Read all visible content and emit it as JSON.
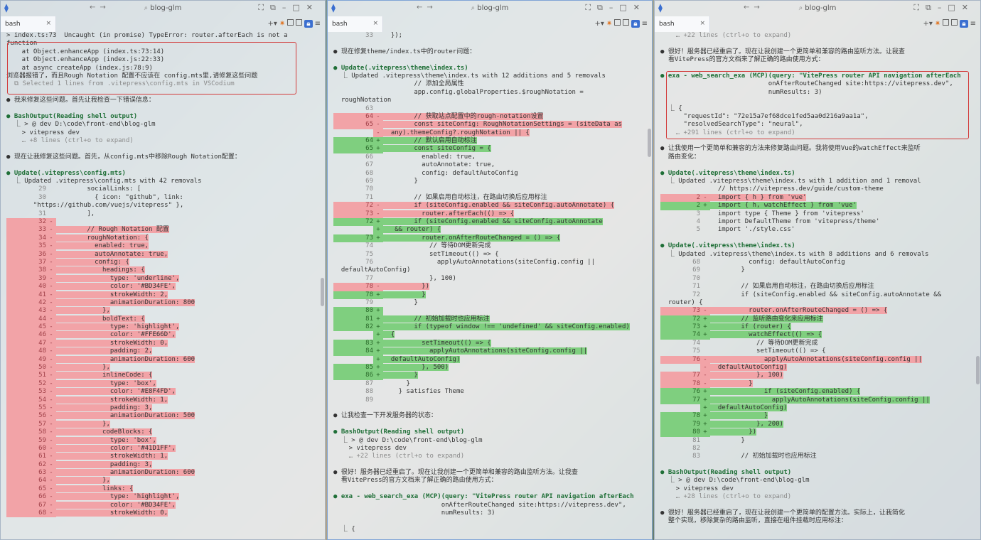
{
  "windows": [
    {
      "title": "blog-glm",
      "tab": "bash",
      "lines": [
        {
          "t": "> index.ts:73  Uncaught (in promise) TypeError: router.afterEach is not a"
        },
        {
          "t": "function"
        },
        {
          "t": "    at Object.enhanceApp (index.ts:73:14)"
        },
        {
          "t": "    at Object.enhanceApp (index.js:22:33)"
        },
        {
          "t": "    at async createApp (index.js:78:9)"
        },
        {
          "t": "浏览器报错了，而且Rough Notation 配置不应该在 config.mts里,请修复这些问题"
        },
        {
          "t": "  ⧉ Selected 1 lines from .vitepress\\config.mts in VSCodium",
          "c": "gray"
        },
        {
          "t": ""
        },
        {
          "t": "● 我来修复这些问题。首先让我检查一下错误信息："
        },
        {
          "t": ""
        },
        {
          "t": "● BashOutput(Reading shell output)",
          "c": "tool"
        },
        {
          "t": "  ⎿ > @ dev D:\\code\\front-end\\blog-glm"
        },
        {
          "t": "    > vitepress dev"
        },
        {
          "t": "    … +8 lines (ctrl+o to expand)",
          "c": "gray"
        },
        {
          "t": ""
        },
        {
          "t": "● 现在让我修复这些问题。首先，从config.mts中移除Rough Notation配置："
        },
        {
          "t": ""
        },
        {
          "t": "● Update(.vitepress\\config.mts)",
          "c": "tool"
        },
        {
          "t": "  ⎿ Updated .vitepress\\config.mts with 42 removals"
        },
        {
          "n": "29",
          "t": "        socialLinks: ["
        },
        {
          "n": "30",
          "t": "          { icon: \"github\", link:"
        },
        {
          "t": "       \"https://github.com/vuejs/vitepress\" },"
        },
        {
          "n": "31",
          "t": "        ],"
        },
        {
          "n": "32",
          "m": "-",
          "d": "r",
          "t": ""
        },
        {
          "n": "33",
          "m": "-",
          "d": "r",
          "t": "        // Rough Notation 配置"
        },
        {
          "n": "34",
          "m": "-",
          "d": "r",
          "t": "        roughNotation: {"
        },
        {
          "n": "35",
          "m": "-",
          "d": "r",
          "t": "          enabled: true,"
        },
        {
          "n": "36",
          "m": "-",
          "d": "r",
          "t": "          autoAnnotate: true,"
        },
        {
          "n": "37",
          "m": "-",
          "d": "r",
          "t": "          config: {"
        },
        {
          "n": "38",
          "m": "-",
          "d": "r",
          "t": "            headings: {"
        },
        {
          "n": "39",
          "m": "-",
          "d": "r",
          "t": "              type: 'underline',"
        },
        {
          "n": "40",
          "m": "-",
          "d": "r",
          "t": "              color: '#BD34FE',"
        },
        {
          "n": "41",
          "m": "-",
          "d": "r",
          "t": "              strokeWidth: 2,"
        },
        {
          "n": "42",
          "m": "-",
          "d": "r",
          "t": "              animationDuration: 800"
        },
        {
          "n": "43",
          "m": "-",
          "d": "r",
          "t": "            },"
        },
        {
          "n": "44",
          "m": "-",
          "d": "r",
          "t": "            boldText: {"
        },
        {
          "n": "45",
          "m": "-",
          "d": "r",
          "t": "              type: 'highlight',"
        },
        {
          "n": "46",
          "m": "-",
          "d": "r",
          "t": "              color: '#FFE66D',"
        },
        {
          "n": "47",
          "m": "-",
          "d": "r",
          "t": "              strokeWidth: 0,"
        },
        {
          "n": "48",
          "m": "-",
          "d": "r",
          "t": "              padding: 2,"
        },
        {
          "n": "49",
          "m": "-",
          "d": "r",
          "t": "              animationDuration: 600"
        },
        {
          "n": "50",
          "m": "-",
          "d": "r",
          "t": "            },"
        },
        {
          "n": "51",
          "m": "-",
          "d": "r",
          "t": "            inlineCode: {"
        },
        {
          "n": "52",
          "m": "-",
          "d": "r",
          "t": "              type: 'box',"
        },
        {
          "n": "53",
          "m": "-",
          "d": "r",
          "t": "              color: '#E8F4FD',"
        },
        {
          "n": "54",
          "m": "-",
          "d": "r",
          "t": "              strokeWidth: 1,"
        },
        {
          "n": "55",
          "m": "-",
          "d": "r",
          "t": "              padding: 3,"
        },
        {
          "n": "56",
          "m": "-",
          "d": "r",
          "t": "              animationDuration: 500"
        },
        {
          "n": "57",
          "m": "-",
          "d": "r",
          "t": "            },"
        },
        {
          "n": "58",
          "m": "-",
          "d": "r",
          "t": "            codeBlocks: {"
        },
        {
          "n": "59",
          "m": "-",
          "d": "r",
          "t": "              type: 'box',"
        },
        {
          "n": "60",
          "m": "-",
          "d": "r",
          "t": "              color: '#41D1FF',"
        },
        {
          "n": "61",
          "m": "-",
          "d": "r",
          "t": "              strokeWidth: 1,"
        },
        {
          "n": "62",
          "m": "-",
          "d": "r",
          "t": "              padding: 3,"
        },
        {
          "n": "63",
          "m": "-",
          "d": "r",
          "t": "              animationDuration: 600"
        },
        {
          "n": "64",
          "m": "-",
          "d": "r",
          "t": "            },"
        },
        {
          "n": "65",
          "m": "-",
          "d": "r",
          "t": "            links: {"
        },
        {
          "n": "66",
          "m": "-",
          "d": "r",
          "t": "              type: 'highlight',"
        },
        {
          "n": "67",
          "m": "-",
          "d": "r",
          "t": "              color: '#BD34FE',"
        },
        {
          "n": "68",
          "m": "-",
          "d": "r",
          "t": "              strokeWidth: 0,"
        }
      ]
    },
    {
      "title": "blog-glm",
      "tab": "bash",
      "lines": [
        {
          "n": "33",
          "t": "  });"
        },
        {
          "t": ""
        },
        {
          "t": "● 现在修复theme/index.ts中的router问题："
        },
        {
          "t": ""
        },
        {
          "t": "● Update(.vitepress\\theme\\index.ts)",
          "c": "tool"
        },
        {
          "t": "  ⎿ Updated .vitepress\\theme\\index.ts with 12 additions and 5 removals"
        },
        {
          "n": "",
          "t": "        // 添加全局属性"
        },
        {
          "n": "",
          "t": "        app.config.globalProperties.$roughNotation ="
        },
        {
          "t": "  roughNotation"
        },
        {
          "n": "63",
          "t": ""
        },
        {
          "n": "64",
          "m": "-",
          "d": "r",
          "t": "        // 获取站点配置中的rough-notation设置"
        },
        {
          "n": "65",
          "m": "-",
          "d": "r",
          "t": "        const siteConfig: RoughNotationSettings = (siteData as"
        },
        {
          "m": "-",
          "d": "r",
          "t": "  any).themeConfig?.roughNotation || {"
        },
        {
          "n": "64",
          "m": "+",
          "d": "g",
          "t": "        // 默认启用自动标注"
        },
        {
          "n": "65",
          "m": "+",
          "d": "g",
          "t": "        const siteConfig = {"
        },
        {
          "n": "66",
          "t": "          enabled: true,"
        },
        {
          "n": "67",
          "t": "          autoAnnotate: true,"
        },
        {
          "n": "68",
          "t": "          config: defaultAutoConfig"
        },
        {
          "n": "69",
          "t": "        }"
        },
        {
          "n": "70",
          "t": ""
        },
        {
          "n": "71",
          "t": "        // 如果启用自动标注，在路由切换后应用标注"
        },
        {
          "n": "72",
          "m": "-",
          "d": "r",
          "t": "        if (siteConfig.enabled && siteConfig.autoAnnotate) {"
        },
        {
          "n": "73",
          "m": "-",
          "d": "r",
          "t": "          router.afterEach(() => {"
        },
        {
          "n": "72",
          "m": "+",
          "d": "g",
          "t": "        if (siteConfig.enabled && siteConfig.autoAnnotate"
        },
        {
          "m": "+",
          "d": "g",
          "t": "   && router) {"
        },
        {
          "n": "73",
          "m": "+",
          "d": "g",
          "t": "          router.onAfterRouteChanged = () => {"
        },
        {
          "n": "74",
          "t": "            // 等待DOM更新完成"
        },
        {
          "n": "75",
          "t": "            setTimeout(() => {"
        },
        {
          "n": "76",
          "t": "              applyAutoAnnotations(siteConfig.config ||"
        },
        {
          "t": "  defaultAutoConfig)"
        },
        {
          "n": "77",
          "t": "            }, 100)"
        },
        {
          "n": "78",
          "m": "-",
          "d": "r",
          "t": "          })"
        },
        {
          "n": "78",
          "m": "+",
          "d": "g",
          "t": "          }"
        },
        {
          "n": "79",
          "t": "        }"
        },
        {
          "n": "80",
          "m": "+",
          "d": "g",
          "t": ""
        },
        {
          "n": "81",
          "m": "+",
          "d": "g",
          "t": "        // 初始加载时也应用标注"
        },
        {
          "n": "82",
          "m": "+",
          "d": "g",
          "t": "        if (typeof window !== 'undefined' && siteConfig.enabled)"
        },
        {
          "m": "+",
          "d": "g",
          "t": "  {"
        },
        {
          "n": "83",
          "m": "+",
          "d": "g",
          "t": "          setTimeout(() => {"
        },
        {
          "n": "84",
          "m": "+",
          "d": "g",
          "t": "            applyAutoAnnotations(siteConfig.config ||"
        },
        {
          "m": "+",
          "d": "g",
          "t": "  defaultAutoConfig)"
        },
        {
          "n": "85",
          "m": "+",
          "d": "g",
          "t": "          }, 500)"
        },
        {
          "n": "86",
          "m": "+",
          "d": "g",
          "t": "        }"
        },
        {
          "n": "87",
          "t": "      }"
        },
        {
          "n": "88",
          "t": "    } satisfies Theme"
        },
        {
          "n": "89",
          "t": ""
        },
        {
          "t": ""
        },
        {
          "t": "● 让我检查一下开发服务器的状态："
        },
        {
          "t": ""
        },
        {
          "t": "● BashOutput(Reading shell output)",
          "c": "tool"
        },
        {
          "t": "  ⎿ > @ dev D:\\code\\front-end\\blog-glm"
        },
        {
          "t": "    > vitepress dev"
        },
        {
          "t": "    … +22 lines (ctrl+o to expand)",
          "c": "gray"
        },
        {
          "t": ""
        },
        {
          "t": "● 很好！服务器已经重启了。现在让我创建一个更简单和兼容的路由监听方法。让我查"
        },
        {
          "t": "  看VitePress的官方文档来了解正确的路由使用方式："
        },
        {
          "t": ""
        },
        {
          "t": "● exa - web_search_exa (MCP)(query: \"VitePress router API navigation afterEach",
          "c": "tool"
        },
        {
          "t": "                            onAfterRouteChanged site:https://vitepress.dev\","
        },
        {
          "t": "                            numResults: 3)"
        },
        {
          "t": ""
        },
        {
          "t": "  ⎿ {"
        }
      ]
    },
    {
      "title": "blog-glm",
      "tab": "bash",
      "lines": [
        {
          "t": "    … +22 lines (ctrl+o to expand)",
          "c": "gray"
        },
        {
          "t": ""
        },
        {
          "t": "● 很好！服务器已经重启了。现在让我创建一个更简单和兼容的路由监听方法。让我查"
        },
        {
          "t": "  看VitePress的官方文档来了解正确的路由使用方式："
        },
        {
          "t": ""
        },
        {
          "t": "● exa - web_search_exa (MCP)(query: \"VitePress router API navigation afterEach",
          "c": "tool"
        },
        {
          "t": "                            onAfterRouteChanged site:https://vitepress.dev\","
        },
        {
          "t": "                            numResults: 3)"
        },
        {
          "t": ""
        },
        {
          "t": "  ⎿ {"
        },
        {
          "t": "      \"requestId\": \"72e15a7ef68dce1fed5aa0d216a9aa1a\","
        },
        {
          "t": "      \"resolvedSearchType\": \"neural\","
        },
        {
          "t": "    … +291 lines (ctrl+o to expand)",
          "c": "gray"
        },
        {
          "t": ""
        },
        {
          "t": "● 让我使用一个更简单和兼容的方法来修复路由问题。我将使用Vue的watchEffect来监听"
        },
        {
          "t": "  路由变化："
        },
        {
          "t": ""
        },
        {
          "t": "● Update(.vitepress\\theme\\index.ts)",
          "c": "tool"
        },
        {
          "t": "  ⎿ Updated .vitepress\\theme\\index.ts with 1 addition and 1 removal"
        },
        {
          "n": "",
          "t": "  // https://vitepress.dev/guide/custom-theme"
        },
        {
          "n": "2",
          "m": "-",
          "d": "r",
          "t": "  import { h } from 'vue'"
        },
        {
          "n": "2",
          "m": "+",
          "d": "g",
          "t": "  import { h, watchEffect } from 'vue'"
        },
        {
          "n": "3",
          "t": "  import type { Theme } from 'vitepress'"
        },
        {
          "n": "4",
          "t": "  import DefaultTheme from 'vitepress/theme'"
        },
        {
          "n": "5",
          "t": "  import './style.css'"
        },
        {
          "t": ""
        },
        {
          "t": "● Update(.vitepress\\theme\\index.ts)",
          "c": "tool"
        },
        {
          "t": "  ⎿ Updated .vitepress\\theme\\index.ts with 8 additions and 6 removals"
        },
        {
          "n": "68",
          "t": "          config: defaultAutoConfig"
        },
        {
          "n": "69",
          "t": "        }"
        },
        {
          "n": "70",
          "t": ""
        },
        {
          "n": "71",
          "t": "        // 如果启用自动标注，在路由切换后应用标注"
        },
        {
          "n": "72",
          "t": "        if (siteConfig.enabled && siteConfig.autoAnnotate &&"
        },
        {
          "t": "  router) {"
        },
        {
          "n": "73",
          "m": "-",
          "d": "r",
          "t": "          router.onAfterRouteChanged = () => {"
        },
        {
          "n": "72",
          "m": "+",
          "d": "g",
          "t": "        // 监听路由变化来应用标注"
        },
        {
          "n": "73",
          "m": "+",
          "d": "g",
          "t": "        if (router) {"
        },
        {
          "n": "74",
          "m": "+",
          "d": "g",
          "t": "          watchEffect(() => {"
        },
        {
          "n": "74",
          "t": "            // 等待DOM更新完成"
        },
        {
          "n": "75",
          "t": "            setTimeout(() => {"
        },
        {
          "n": "76",
          "m": "-",
          "d": "r",
          "t": "              applyAutoAnnotations(siteConfig.config ||"
        },
        {
          "m": "-",
          "d": "r",
          "t": "  defaultAutoConfig)"
        },
        {
          "n": "77",
          "m": "-",
          "d": "r",
          "t": "            }, 100)"
        },
        {
          "n": "78",
          "m": "-",
          "d": "r",
          "t": "          }"
        },
        {
          "n": "76",
          "m": "+",
          "d": "g",
          "t": "              if (siteConfig.enabled) {"
        },
        {
          "n": "77",
          "m": "+",
          "d": "g",
          "t": "                applyAutoAnnotations(siteConfig.config ||"
        },
        {
          "m": "+",
          "d": "g",
          "t": "  defaultAutoConfig)"
        },
        {
          "n": "78",
          "m": "+",
          "d": "g",
          "t": "              }"
        },
        {
          "n": "79",
          "m": "+",
          "d": "g",
          "t": "            }, 200)"
        },
        {
          "n": "80",
          "m": "+",
          "d": "g",
          "t": "          })"
        },
        {
          "n": "81",
          "t": "        }"
        },
        {
          "n": "82",
          "t": ""
        },
        {
          "n": "83",
          "t": "        // 初始加载时也应用标注"
        },
        {
          "t": ""
        },
        {
          "t": "● BashOutput(Reading shell output)",
          "c": "tool"
        },
        {
          "t": "  ⎿ > @ dev D:\\code\\front-end\\blog-glm"
        },
        {
          "t": "    > vitepress dev"
        },
        {
          "t": "    … +28 lines (ctrl+o to expand)",
          "c": "gray"
        },
        {
          "t": ""
        },
        {
          "t": "● 很好！服务器已经重启了，现在让我创建一个更简单的配置方法。实际上，让我简化"
        },
        {
          "t": "  整个实现，移除复杂的路由监听，直接在组件挂载时应用标注："
        }
      ]
    }
  ]
}
